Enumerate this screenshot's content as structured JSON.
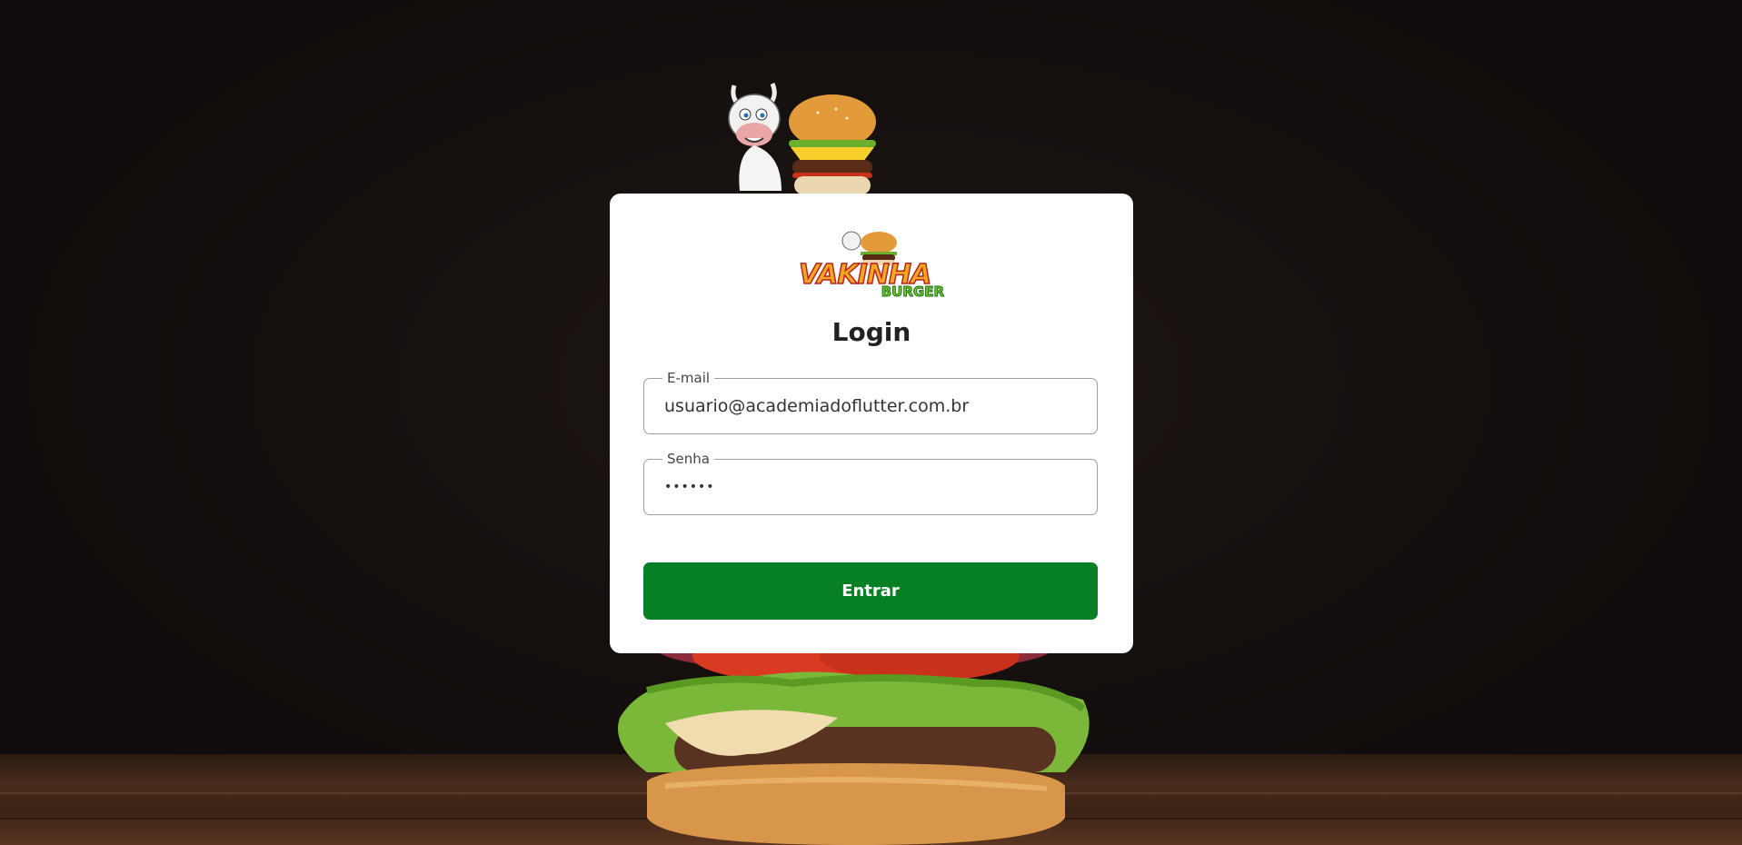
{
  "brand": {
    "name": "VAKINHA",
    "subtitle": "BURGER",
    "accent": "#f5a623",
    "sub_color": "#6fcf2a"
  },
  "login": {
    "title": "Login",
    "email": {
      "label": "E-mail",
      "value": "usuario@academiadoflutter.com.br"
    },
    "password": {
      "label": "Senha",
      "value": "••••••"
    },
    "submit_label": "Entrar"
  },
  "colors": {
    "background": "#130e0d",
    "card": "#ffffff",
    "button": "#067f25"
  },
  "icons": [
    "cow-mascot-icon",
    "burger-icon",
    "background-burger-image"
  ]
}
